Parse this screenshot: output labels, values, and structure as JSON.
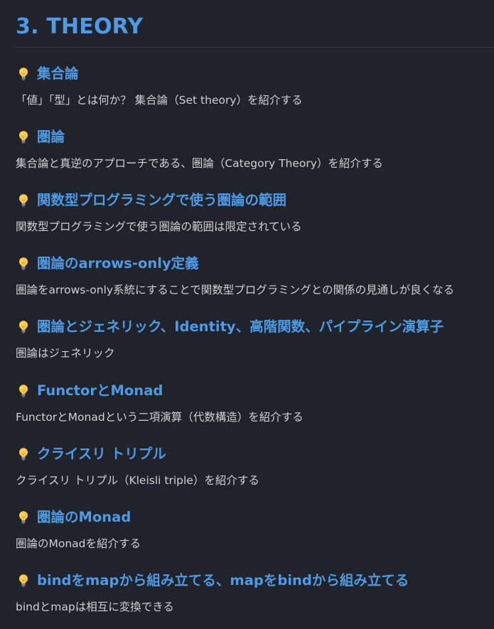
{
  "title": "3. THEORY",
  "icon": "lightbulb-icon",
  "colors": {
    "background": "#202329",
    "accent": "#4d9be6",
    "text": "#cdd1d6",
    "bulb": "#f7c948"
  },
  "sections": [
    {
      "heading": "集合論",
      "description": "「値」「型」とは何か？ 集合論（Set theory）を紹介する"
    },
    {
      "heading": "圏論",
      "description": "集合論と真逆のアプローチである、圏論（Category Theory）を紹介する"
    },
    {
      "heading": "関数型プログラミングで使う圏論の範囲",
      "description": "関数型プログラミングで使う圏論の範囲は限定されている"
    },
    {
      "heading": "圏論のarrows-only定義",
      "description": "圏論をarrows-only系統にすることで関数型プログラミングとの関係の見通しが良くなる"
    },
    {
      "heading": "圏論とジェネリック、Identity、高階関数、パイプライン演算子",
      "description": "圏論はジェネリック"
    },
    {
      "heading": "FunctorとMonad",
      "description": "FunctorとMonadという二項演算（代数構造）を紹介する"
    },
    {
      "heading": "クライスリ トリプル",
      "description": "クライスリ トリプル（Kleisli triple）を紹介する"
    },
    {
      "heading": "圏論のMonad",
      "description": "圏論のMonadを紹介する"
    },
    {
      "heading": "bindをmapから組み立てる、mapをbindから組み立てる",
      "description": "bindとmapは相互に変換できる"
    }
  ]
}
